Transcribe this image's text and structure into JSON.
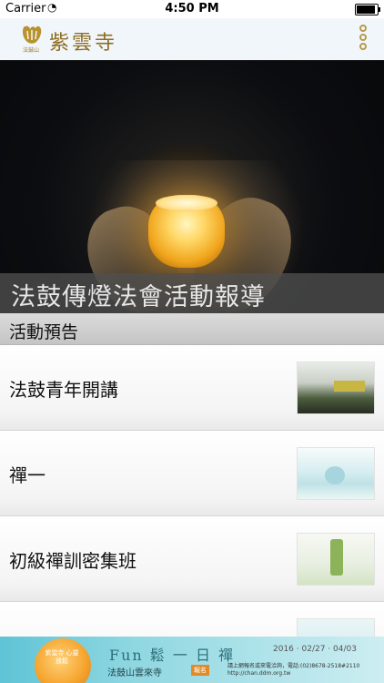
{
  "status_bar": {
    "carrier": "Carrier",
    "wifi_icon": "wifi-icon",
    "time": "4:50 PM",
    "battery_icon": "battery-full-icon",
    "battery_level": 1.0
  },
  "header": {
    "logo_text": "紫雲寺",
    "logo_subtext": "法鼓山",
    "menu_icon": "three-circles-menu-icon",
    "accent_color": "#b89a4e"
  },
  "hero": {
    "caption": "法鼓傳燈法會活動報導"
  },
  "section": {
    "title": "活動預告"
  },
  "events": [
    {
      "title": "法鼓青年開講"
    },
    {
      "title": "禪一"
    },
    {
      "title": "初級禪訓密集班"
    },
    {
      "title": ""
    }
  ],
  "banner": {
    "orb_text": "紫雲寺 心靈放鬆",
    "event_title": "Fun 鬆 一 日 禪",
    "dates": "2016 · 02/27 · 04/03",
    "organizer": "法鼓山雲來寺",
    "tag": "報名",
    "info": "請上網報名或來電洽詢，電話:(02)8678-2518#2110 http://chan.ddm.org.tw"
  }
}
